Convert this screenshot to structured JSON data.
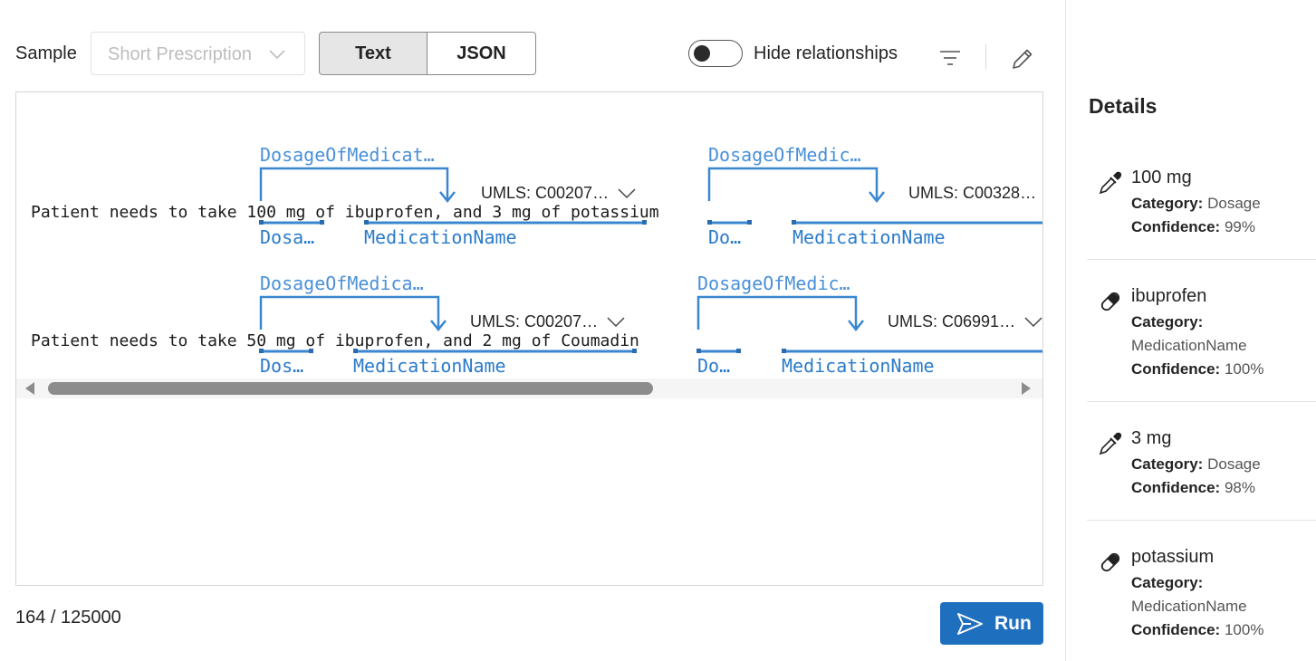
{
  "toolbar": {
    "sample_label": "Sample",
    "sample_value": "Short Prescription",
    "text_tab": "Text",
    "json_tab": "JSON",
    "toggle_label": "Hide relationships"
  },
  "lines": [
    {
      "text": "Patient needs to take 100 mg of ibuprofen",
      "suffix": ", and 3 mg of potassium",
      "rel1": "DosageOfMedicat…",
      "rel2": "DosageOfMedic…",
      "dose1_label": "Dosa…",
      "med1_label": "MedicationName",
      "umls1": "UMLS: C00207…",
      "dose2_label": "Do…",
      "med2_label": "MedicationName",
      "umls2": "UMLS: C00328…"
    },
    {
      "text": "Patient needs to take 50 mg of ibuprofen",
      "suffix": ", and 2 mg of Coumadin",
      "rel1": "DosageOfMedica…",
      "rel2": "DosageOfMedic…",
      "dose1_label": "Dos…",
      "med1_label": "MedicationName",
      "umls1": "UMLS: C00207…",
      "dose2_label": "Do…",
      "med2_label": "MedicationName",
      "umls2": "UMLS: C06991…"
    }
  ],
  "counter": "164 / 125000",
  "run_label": "Run",
  "details": {
    "title": "Details",
    "category_key": "Category:",
    "confidence_key": "Confidence:",
    "items": [
      {
        "name": "100 mg",
        "category": "Dosage",
        "confidence": "99%",
        "icon": "dropper-icon"
      },
      {
        "name": "ibuprofen",
        "category": "MedicationName",
        "confidence": "100%",
        "icon": "pill-icon"
      },
      {
        "name": "3 mg",
        "category": "Dosage",
        "confidence": "98%",
        "icon": "dropper-icon"
      },
      {
        "name": "potassium",
        "category": "MedicationName",
        "confidence": "100%",
        "icon": "pill-icon"
      }
    ]
  },
  "colors": {
    "accent": "#1f6fbf",
    "relationship": "#4a90d9",
    "entity": "#2b7bc9"
  }
}
